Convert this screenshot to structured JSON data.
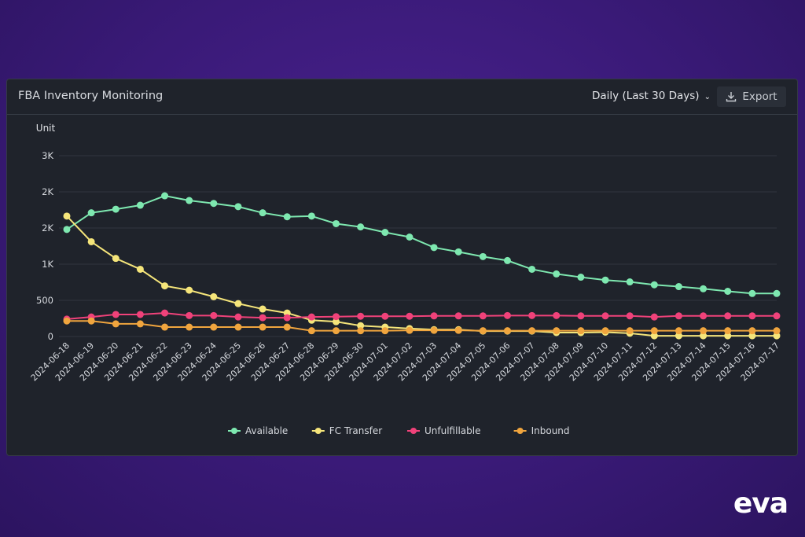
{
  "card": {
    "title": "FBA Inventory Monitoring",
    "range_label": "Daily (Last 30 Days)",
    "export_label": "Export"
  },
  "brand": {
    "logo_text": "eva"
  },
  "chart_data": {
    "type": "line",
    "title": "",
    "ylabel": "Unit",
    "xlabel": "",
    "ylim": [
      0,
      2500
    ],
    "yticks": [
      0,
      500,
      1000,
      1500,
      2000,
      2500
    ],
    "ytick_labels": [
      "0",
      "500",
      "1K",
      "2K",
      "2K",
      "3K"
    ],
    "grid": true,
    "legend_position": "bottom",
    "x": [
      "2024-06-18",
      "2024-06-19",
      "2024-06-20",
      "2024-06-21",
      "2024-06-22",
      "2024-06-23",
      "2024-06-24",
      "2024-06-25",
      "2024-06-26",
      "2024-06-27",
      "2024-06-28",
      "2024-06-29",
      "2024-06-30",
      "2024-07-01",
      "2024-07-02",
      "2024-07-03",
      "2024-07-04",
      "2024-07-05",
      "2024-07-06",
      "2024-07-07",
      "2024-07-08",
      "2024-07-09",
      "2024-07-10",
      "2024-07-11",
      "2024-07-12",
      "2024-07-13",
      "2024-07-14",
      "2024-07-15",
      "2024-07-16",
      "2024-07-17"
    ],
    "series": [
      {
        "name": "Available",
        "color": "#7ee8b0",
        "values": [
          1480,
          1710,
          1760,
          1815,
          1945,
          1880,
          1840,
          1795,
          1710,
          1655,
          1665,
          1560,
          1515,
          1440,
          1375,
          1230,
          1170,
          1105,
          1050,
          930,
          865,
          820,
          780,
          755,
          715,
          690,
          660,
          625,
          595,
          595
        ]
      },
      {
        "name": "FC Transfer",
        "color": "#f5e57a",
        "values": [
          1665,
          1310,
          1080,
          930,
          700,
          640,
          550,
          455,
          380,
          325,
          225,
          205,
          150,
          130,
          110,
          95,
          95,
          75,
          75,
          75,
          55,
          55,
          60,
          45,
          10,
          10,
          10,
          10,
          10,
          10
        ]
      },
      {
        "name": "Unfulfillable",
        "color": "#f0427a",
        "values": [
          240,
          270,
          305,
          305,
          325,
          290,
          290,
          270,
          260,
          260,
          270,
          275,
          280,
          280,
          280,
          285,
          285,
          285,
          290,
          290,
          290,
          285,
          285,
          285,
          270,
          285,
          285,
          285,
          285,
          285
        ]
      },
      {
        "name": "Inbound",
        "color": "#f0a53e",
        "values": [
          215,
          215,
          175,
          175,
          130,
          130,
          130,
          130,
          130,
          130,
          80,
          80,
          80,
          80,
          85,
          85,
          85,
          80,
          80,
          80,
          80,
          80,
          80,
          80,
          80,
          80,
          80,
          80,
          80,
          80
        ]
      }
    ]
  }
}
